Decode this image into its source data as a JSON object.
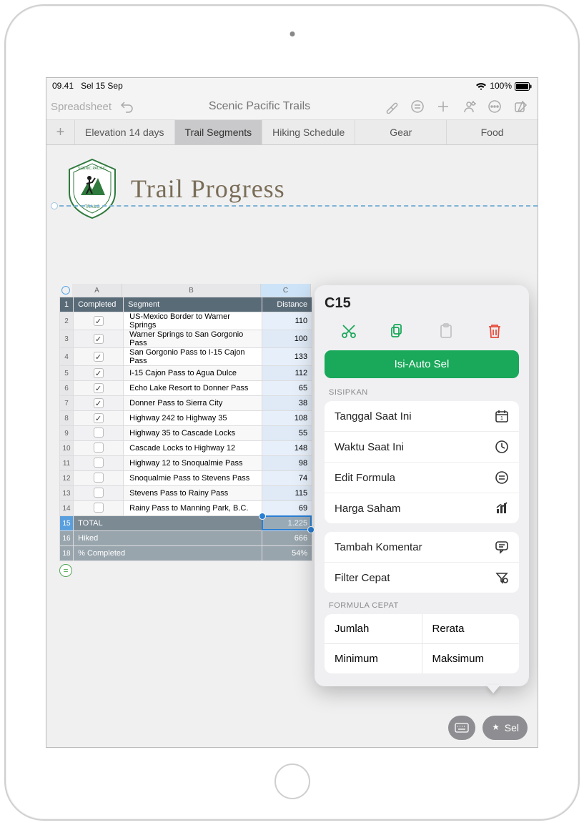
{
  "statusbar": {
    "time": "09.41",
    "date": "Sel 15 Sep",
    "battery": "100%"
  },
  "toolbar": {
    "back_label": "Spreadsheet",
    "doc_title": "Scenic Pacific Trails"
  },
  "tabs": [
    "Elevation 14 days",
    "Trail Segments",
    "Hiking Schedule",
    "Gear",
    "Food"
  ],
  "active_tab_index": 1,
  "doc": {
    "title": "Trail Progress",
    "logo_text_top": "SCENIC",
    "logo_text_mid": "PACIFIC",
    "logo_text_bot": "TRAILS"
  },
  "columns": {
    "a": "A",
    "b": "B",
    "c": "C"
  },
  "headers": {
    "completed": "Completed",
    "segment": "Segment",
    "distance": "Distance"
  },
  "rows": [
    {
      "n": 2,
      "done": true,
      "segment": "US-Mexico Border to Warner Springs",
      "dist": "110"
    },
    {
      "n": 3,
      "done": true,
      "segment": "Warner Springs to San Gorgonio Pass",
      "dist": "100"
    },
    {
      "n": 4,
      "done": true,
      "segment": "San Gorgonio Pass to I-15 Cajon Pass",
      "dist": "133"
    },
    {
      "n": 5,
      "done": true,
      "segment": "I-15 Cajon Pass to Agua Dulce",
      "dist": "112"
    },
    {
      "n": 6,
      "done": true,
      "segment": "Echo Lake Resort to Donner Pass",
      "dist": "65"
    },
    {
      "n": 7,
      "done": true,
      "segment": "Donner Pass to Sierra City",
      "dist": "38"
    },
    {
      "n": 8,
      "done": true,
      "segment": "Highway 242 to Highway 35",
      "dist": "108"
    },
    {
      "n": 9,
      "done": false,
      "segment": "Highway 35 to Cascade Locks",
      "dist": "55"
    },
    {
      "n": 10,
      "done": false,
      "segment": "Cascade Locks to Highway 12",
      "dist": "148"
    },
    {
      "n": 11,
      "done": false,
      "segment": "Highway 12 to Snoqualmie Pass",
      "dist": "98"
    },
    {
      "n": 12,
      "done": false,
      "segment": "Snoqualmie Pass to Stevens Pass",
      "dist": "74"
    },
    {
      "n": 13,
      "done": false,
      "segment": "Stevens Pass to Rainy Pass",
      "dist": "115"
    },
    {
      "n": 14,
      "done": false,
      "segment": "Rainy Pass to Manning Park, B.C.",
      "dist": "69"
    }
  ],
  "summary": {
    "total_row": 15,
    "total_label": "TOTAL",
    "total_value": "1.225",
    "hiked_row": 16,
    "hiked_label": "Hiked",
    "hiked_value": "666",
    "pct_row": 18,
    "pct_label": "% Completed",
    "pct_value": "54%"
  },
  "panel": {
    "cell_ref": "C15",
    "autofill": "Isi-Auto Sel",
    "insert_label": "SISIPKAN",
    "insert_items": [
      {
        "label": "Tanggal Saat Ini",
        "icon": "calendar"
      },
      {
        "label": "Waktu Saat Ini",
        "icon": "clock"
      },
      {
        "label": "Edit Formula",
        "icon": "equals"
      },
      {
        "label": "Harga Saham",
        "icon": "stocks"
      }
    ],
    "extra_items": [
      {
        "label": "Tambah Komentar",
        "icon": "comment"
      },
      {
        "label": "Filter Cepat",
        "icon": "filter"
      }
    ],
    "quick_label": "FORMULA CEPAT",
    "quick": [
      "Jumlah",
      "Rerata",
      "Minimum",
      "Maksimum"
    ]
  },
  "bottom": {
    "sel_label": "Sel"
  }
}
